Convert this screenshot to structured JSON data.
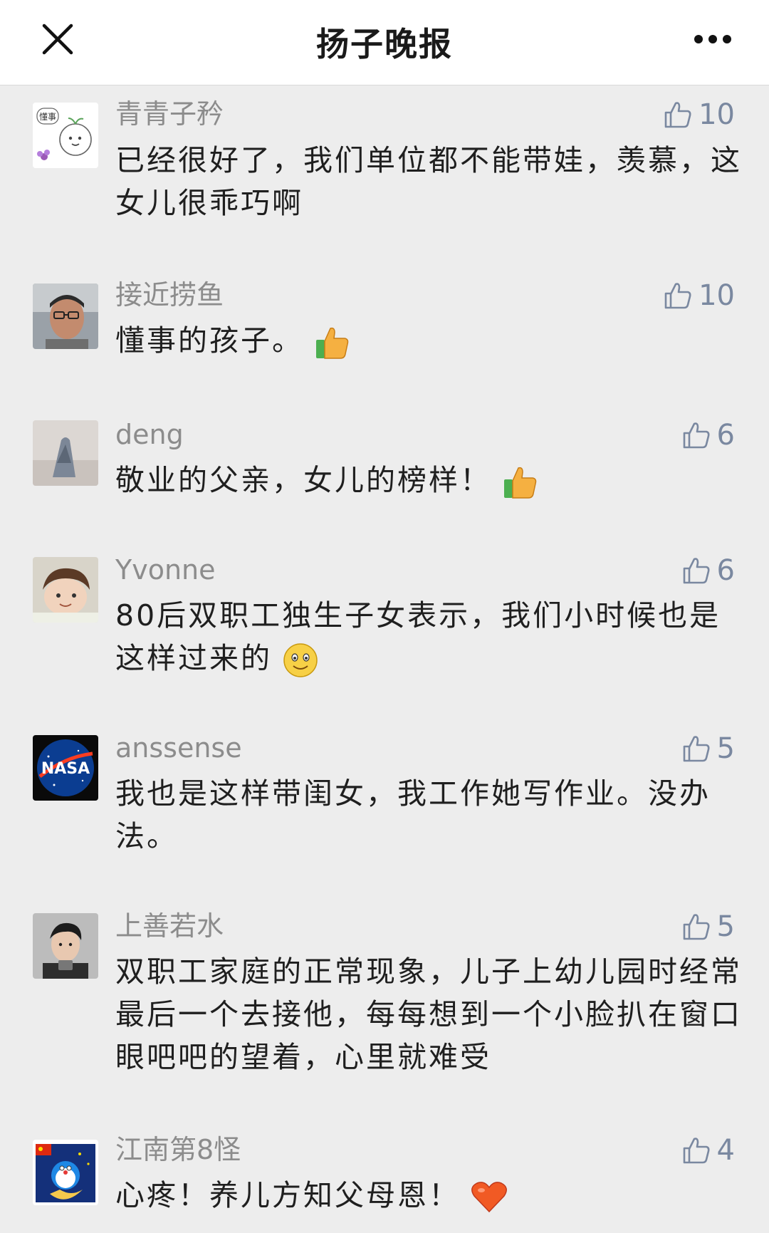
{
  "nav": {
    "title": "扬子晚报",
    "close_icon": "close-icon",
    "more_icon": "more-icon"
  },
  "comments": [
    {
      "nickname": "青青子矜",
      "likes": "10",
      "text": "已经很好了，我们单位都不能带娃，羡慕，这女儿很乖巧啊",
      "emoji": ""
    },
    {
      "nickname": "接近捞鱼",
      "likes": "10",
      "text": "懂事的孩子。",
      "emoji": "thumbs-up-emoji"
    },
    {
      "nickname": "deng",
      "likes": "6",
      "text": "敬业的父亲，女儿的榜样！",
      "emoji": "thumbs-up-emoji"
    },
    {
      "nickname": "Yvonne",
      "likes": "6",
      "text": "80后双职工独生子女表示，我们小时候也是这样过来的",
      "emoji": "smile-emoji"
    },
    {
      "nickname": "anssense",
      "likes": "5",
      "text": "我也是这样带闺女，我工作她写作业。没办法。",
      "emoji": ""
    },
    {
      "nickname": "上善若水",
      "likes": "5",
      "text": "双职工家庭的正常现象，儿子上幼儿园时经常最后一个去接他，每每想到一个小脸扒在窗口眼吧吧的望着，心里就难受",
      "emoji": ""
    },
    {
      "nickname": "江南第8怪",
      "likes": "4",
      "text": "心疼！养儿方知父母恩！",
      "emoji": "heart-emoji"
    }
  ],
  "avatar_badge_text": "懂事",
  "nasa_logo_text": "NASA",
  "colors": {
    "background": "#ededed",
    "nav_background": "#ffffff",
    "nickname": "#8c8c8c",
    "like": "#7a88a0",
    "text": "#1f1f1f"
  }
}
